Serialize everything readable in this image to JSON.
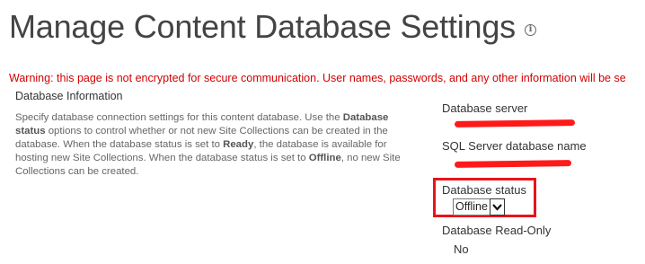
{
  "header": {
    "title": "Manage Content Database Settings",
    "info_icon": "info-icon"
  },
  "warning": {
    "text": "Warning: this page is not encrypted for secure communication. User names, passwords, and any other information will be se",
    "color": "#d40000"
  },
  "section": {
    "title": "Database Information",
    "description": {
      "p1": "Specify database connection settings for this content database. Use the ",
      "b1": "Database status",
      "p2": " options to control whether or not new Site Collections can be created in the database. When the database status is set to ",
      "b2": "Ready",
      "p3": ", the database is available for hosting new Site Collections. When the database status is set to ",
      "b3": "Offline",
      "p4": ", no new Site Collections can be created."
    }
  },
  "fields": {
    "database_server": {
      "label": "Database server"
    },
    "sql_server_database_name": {
      "label": "SQL Server database name"
    },
    "database_status": {
      "label": "Database status",
      "selected": "Offline",
      "highlight_color": "#e8141b"
    },
    "database_read_only": {
      "label": "Database Read-Only",
      "value": "No"
    }
  }
}
